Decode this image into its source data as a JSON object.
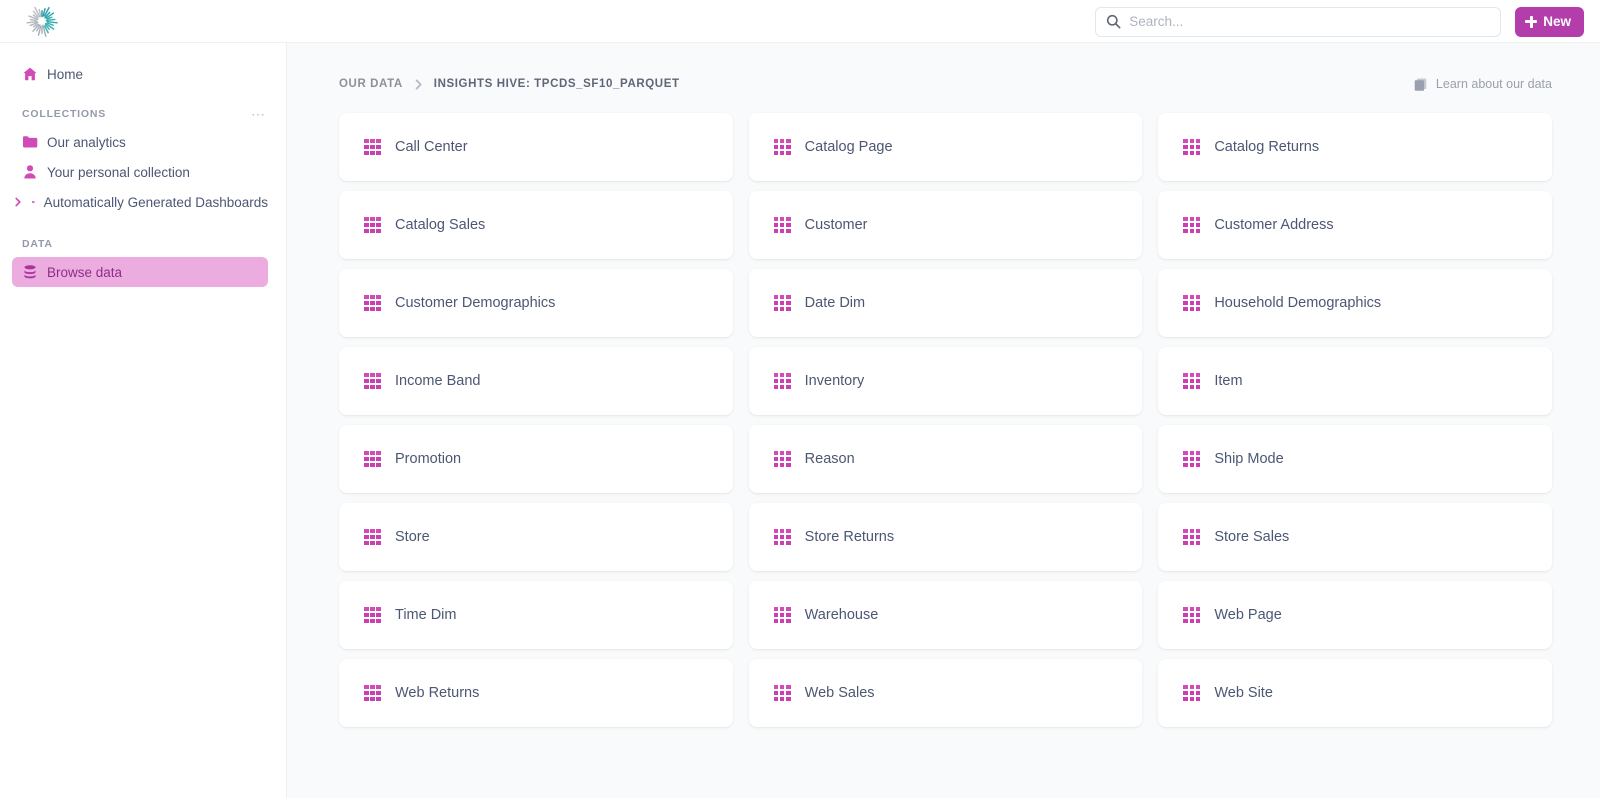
{
  "app": {
    "logo_icon": "metabase-starburst-logo",
    "accent_color": "#b23dab",
    "table_icon_color": "#cc3fb0",
    "active_nav_bg": "#edacdf",
    "page_bg": "#f9fafb"
  },
  "topbar": {
    "search": {
      "icon": "search-icon",
      "placeholder": "Search...",
      "value": ""
    },
    "new_button": {
      "icon": "plus-icon",
      "label": "New"
    }
  },
  "sidebar": {
    "home": {
      "icon": "home-icon",
      "label": "Home"
    },
    "collections_section": {
      "title": "COLLECTIONS",
      "overflow_icon": "ellipsis-icon",
      "items": [
        {
          "icon": "folder-icon",
          "label": "Our analytics",
          "expandable": false
        },
        {
          "icon": "person-icon",
          "label": "Your personal collection",
          "expandable": false
        },
        {
          "icon": "folder-icon",
          "label": "Automatically Generated Dashboards",
          "expandable": true,
          "chevron": "chevron-right-icon"
        }
      ]
    },
    "data_section": {
      "title": "DATA",
      "items": [
        {
          "icon": "database-icon",
          "label": "Browse data",
          "active": true
        }
      ]
    }
  },
  "main": {
    "breadcrumb": {
      "items": [
        {
          "label": "OUR DATA",
          "current": false
        },
        {
          "label": "INSIGHTS HIVE: TPCDS_SF10_PARQUET",
          "current": true
        }
      ],
      "separator_icon": "chevron-right-icon"
    },
    "learn_link": {
      "icon": "book-icon",
      "label": "Learn about our data"
    },
    "tables": [
      {
        "icon": "table-grid-icon",
        "name": "Call Center"
      },
      {
        "icon": "table-grid-icon",
        "name": "Catalog Page"
      },
      {
        "icon": "table-grid-icon",
        "name": "Catalog Returns"
      },
      {
        "icon": "table-grid-icon",
        "name": "Catalog Sales"
      },
      {
        "icon": "table-grid-icon",
        "name": "Customer"
      },
      {
        "icon": "table-grid-icon",
        "name": "Customer Address"
      },
      {
        "icon": "table-grid-icon",
        "name": "Customer Demographics"
      },
      {
        "icon": "table-grid-icon",
        "name": "Date Dim"
      },
      {
        "icon": "table-grid-icon",
        "name": "Household Demographics"
      },
      {
        "icon": "table-grid-icon",
        "name": "Income Band"
      },
      {
        "icon": "table-grid-icon",
        "name": "Inventory"
      },
      {
        "icon": "table-grid-icon",
        "name": "Item"
      },
      {
        "icon": "table-grid-icon",
        "name": "Promotion"
      },
      {
        "icon": "table-grid-icon",
        "name": "Reason"
      },
      {
        "icon": "table-grid-icon",
        "name": "Ship Mode"
      },
      {
        "icon": "table-grid-icon",
        "name": "Store"
      },
      {
        "icon": "table-grid-icon",
        "name": "Store Returns"
      },
      {
        "icon": "table-grid-icon",
        "name": "Store Sales"
      },
      {
        "icon": "table-grid-icon",
        "name": "Time Dim"
      },
      {
        "icon": "table-grid-icon",
        "name": "Warehouse"
      },
      {
        "icon": "table-grid-icon",
        "name": "Web Page"
      },
      {
        "icon": "table-grid-icon",
        "name": "Web Returns"
      },
      {
        "icon": "table-grid-icon",
        "name": "Web Sales"
      },
      {
        "icon": "table-grid-icon",
        "name": "Web Site"
      }
    ]
  }
}
